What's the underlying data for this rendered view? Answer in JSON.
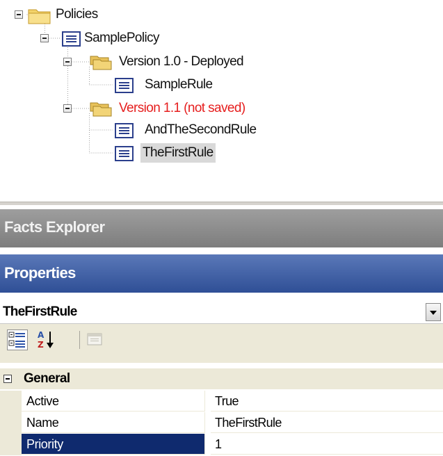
{
  "tree": {
    "nodes": [
      {
        "label": "Policies",
        "icon": "folder-icon"
      },
      {
        "label": "SamplePolicy",
        "icon": "policy-icon"
      },
      {
        "label": "Version 1.0 - Deployed",
        "icon": "version-icon"
      },
      {
        "label": "SampleRule",
        "icon": "rule-icon"
      },
      {
        "label": "Version 1.1 (not saved)",
        "icon": "version-icon",
        "state": "unsaved"
      },
      {
        "label": "AndTheSecondRule",
        "icon": "rule-icon"
      },
      {
        "label": "TheFirstRule",
        "icon": "rule-icon",
        "state": "selected"
      }
    ]
  },
  "panes": {
    "facts_explorer_title": "Facts Explorer",
    "properties_title": "Properties"
  },
  "properties": {
    "selected_object": "TheFirstRule",
    "toolbar": {
      "categorized_icon": "categorized-view-icon",
      "alphabetical_icon": "alphabetical-sort-icon",
      "property_pages_icon": "property-pages-icon"
    },
    "category": "General",
    "rows": [
      {
        "name": "Active",
        "value": "True"
      },
      {
        "name": "Name",
        "value": "TheFirstRule"
      },
      {
        "name": "Priority",
        "value": "1",
        "state": "selected"
      }
    ]
  },
  "colors": {
    "unsaved_text": "#e61e1e",
    "properties_header": "#2f4f96",
    "selected_row": "#0f2a6e"
  }
}
